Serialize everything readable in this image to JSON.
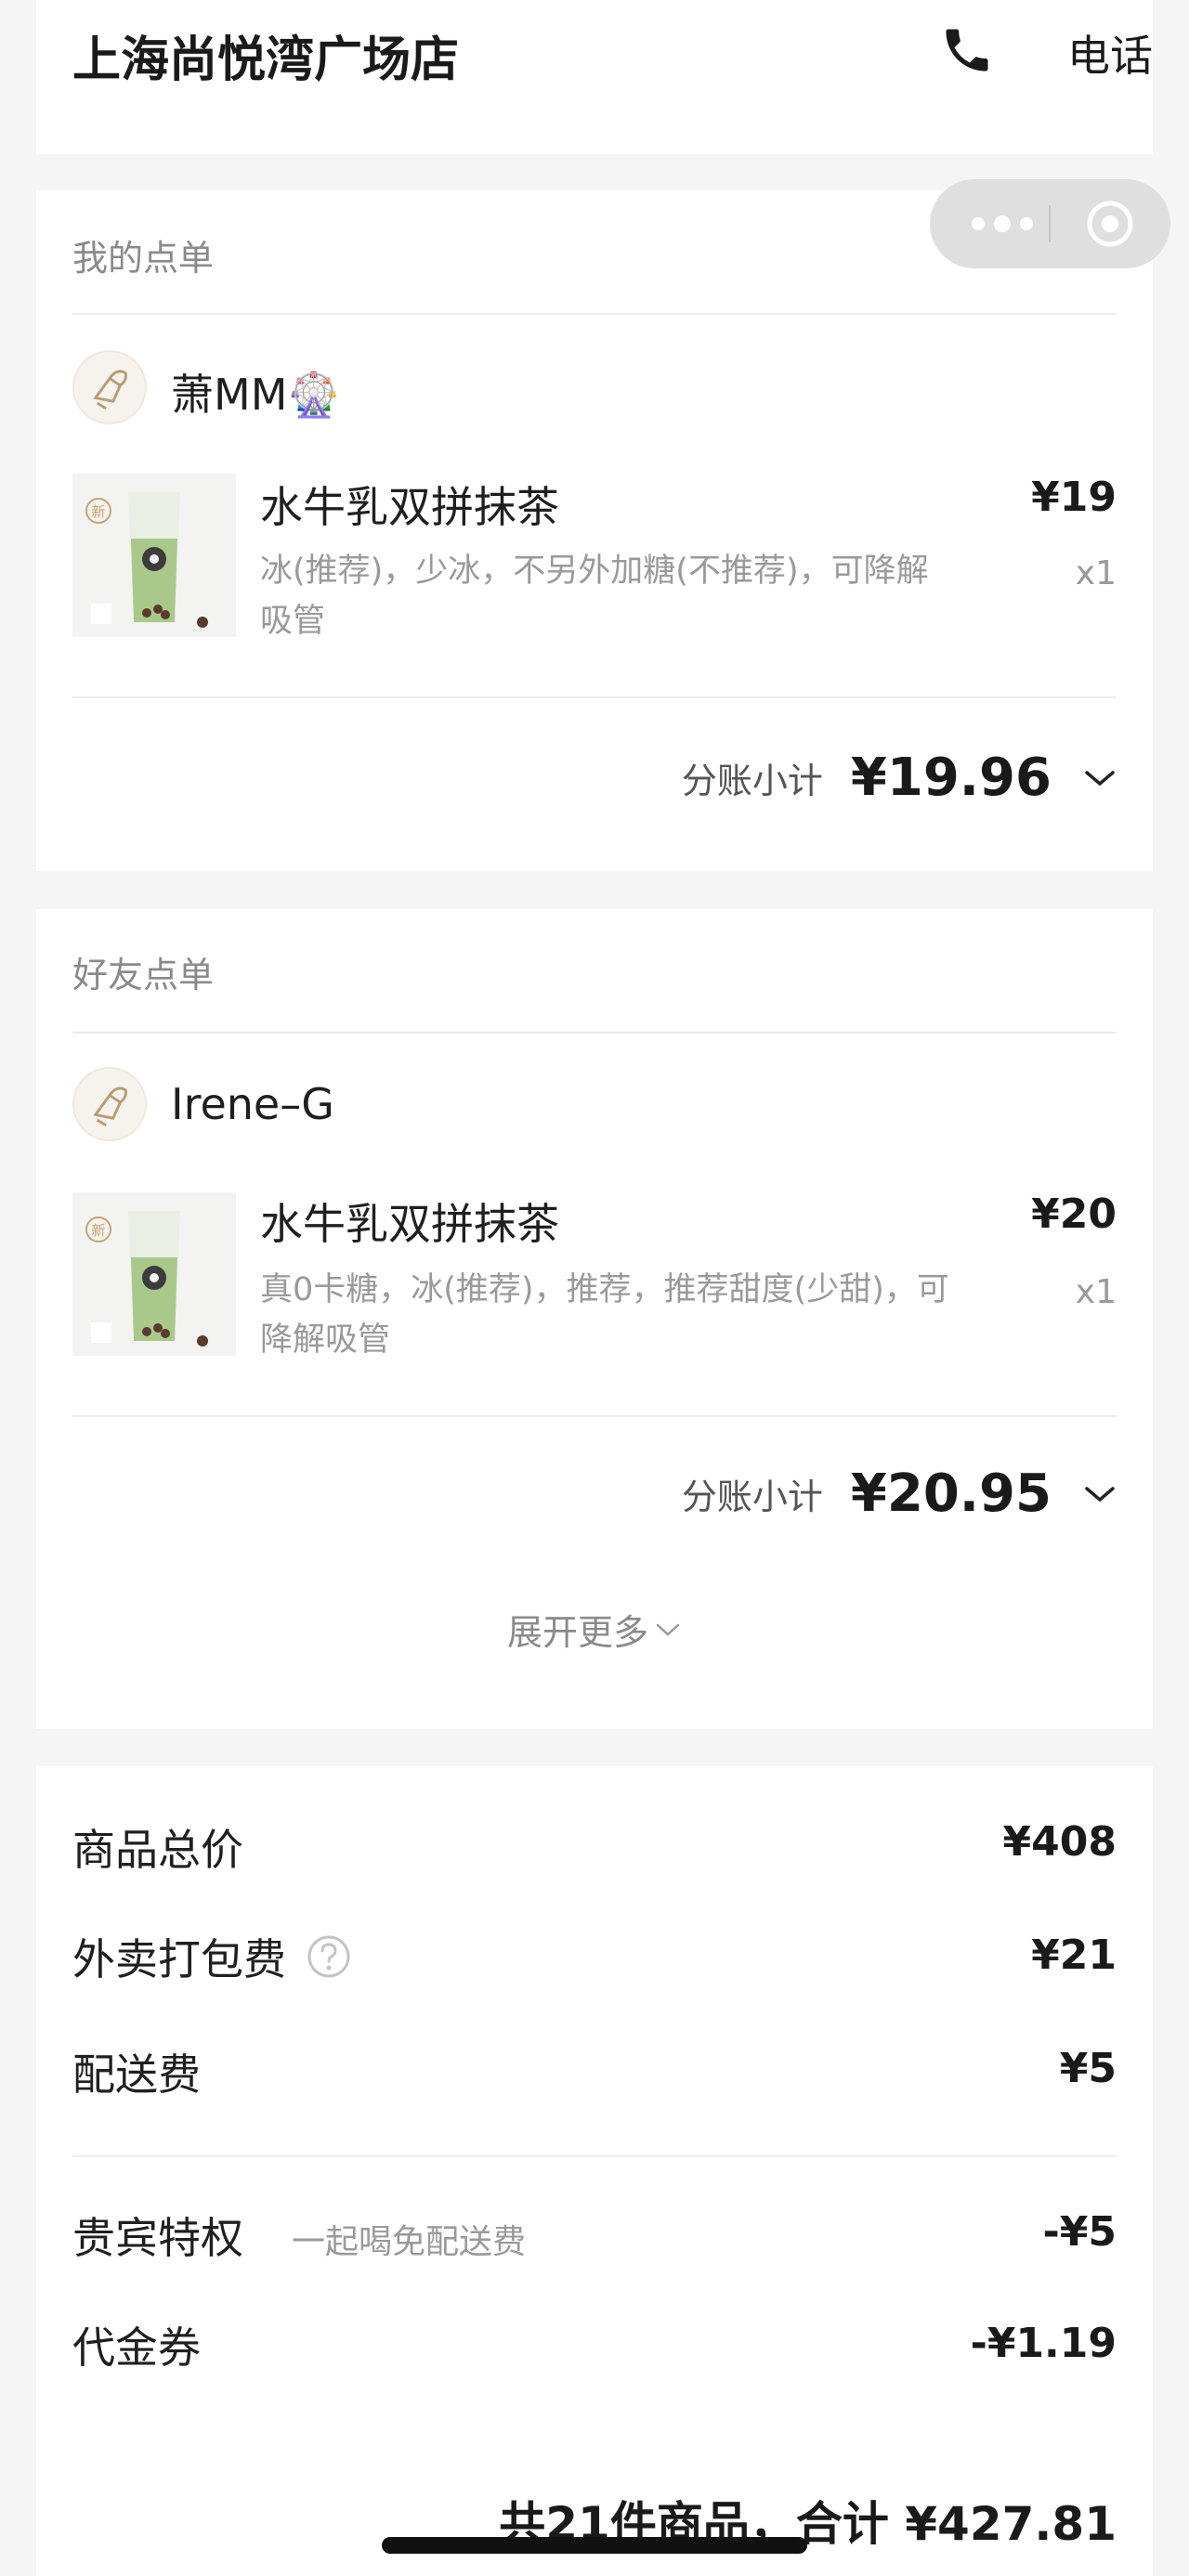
{
  "header": {
    "store_name": "上海尚悦湾广场店",
    "phone_label": "电话",
    "phone_icon": "phone-icon"
  },
  "capsule": {
    "more_icon": "more-dots-icon",
    "close_icon": "target-circle-icon"
  },
  "my_order": {
    "title": "我的点单",
    "user": {
      "name": "萧MM🎡",
      "avatar_icon": "avatar-icon"
    },
    "item": {
      "badge": "新",
      "name": "水牛乳双拼抹茶",
      "options_line1": "冰(推荐)，少冰，不另外加糖(不推荐)，可降解",
      "options_line2": "吸管",
      "price": "¥19",
      "qty": "x1"
    },
    "subtotal_label": "分账小计",
    "subtotal_value": "¥19.96"
  },
  "friend_order": {
    "title": "好友点单",
    "user": {
      "name": "Irene–G",
      "avatar_icon": "avatar-icon"
    },
    "item": {
      "badge": "新",
      "name": "水牛乳双拼抹茶",
      "options_line1": "真0卡糖，冰(推荐)，推荐，推荐甜度(少甜)，可",
      "options_line2": "降解吸管",
      "price": "¥20",
      "qty": "x1"
    },
    "subtotal_label": "分账小计",
    "subtotal_value": "¥20.95",
    "expand_label": "展开更多"
  },
  "summary": {
    "goods_total_label": "商品总价",
    "goods_total_value": "¥408",
    "packing_fee_label": "外卖打包费",
    "packing_fee_value": "¥21",
    "delivery_fee_label": "配送费",
    "delivery_fee_value": "¥5",
    "vip_label": "贵宾特权",
    "vip_desc": "一起喝免配送费",
    "vip_value": "-¥5",
    "voucher_label": "代金券",
    "voucher_value": "-¥1.19",
    "total_text": "共21件商品，合计 ¥427.81"
  },
  "colors": {
    "page_bg": "#f5f5f5",
    "card_bg": "#ffffff",
    "text_primary": "#1a1a1a",
    "text_secondary": "#9a9a9a",
    "avatar_line": "#b89b73"
  }
}
